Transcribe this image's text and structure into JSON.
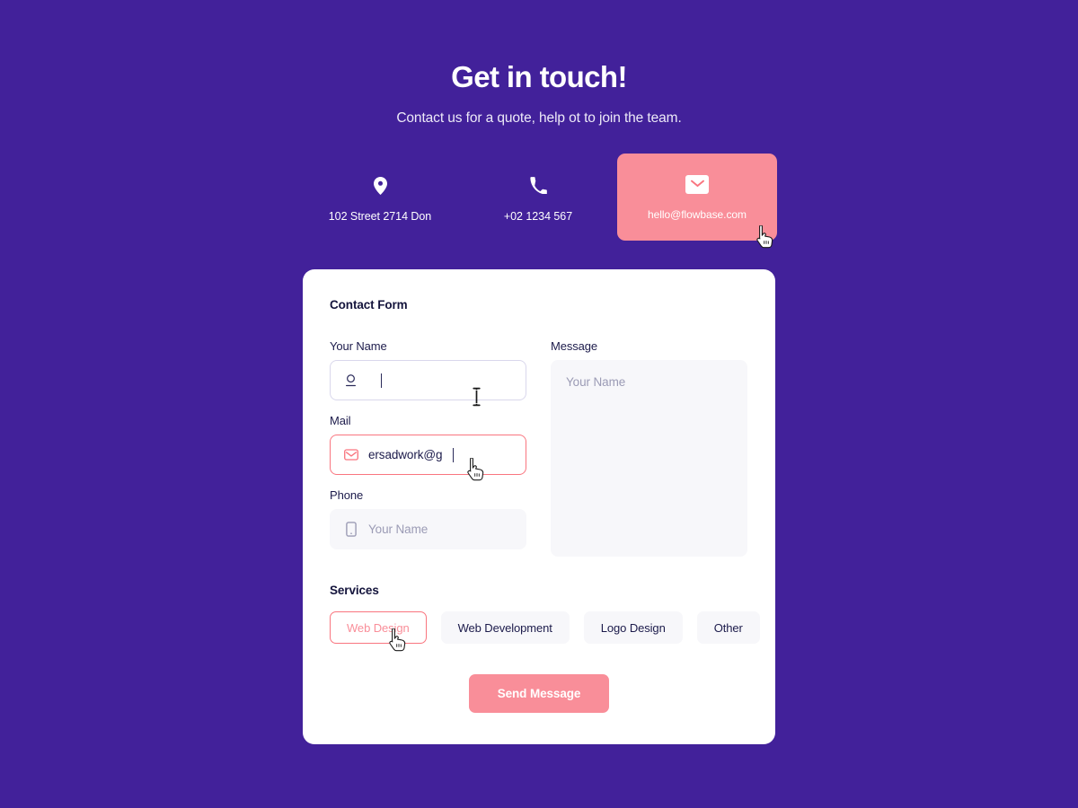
{
  "theme": {
    "background": "#42219A",
    "accent": "#F98E99",
    "accent_border": "#F9757F",
    "card_background": "#FFFFFF",
    "input_background": "#F7F7FA",
    "text_dark": "#1C1B4B",
    "placeholder": "#9B9BB5"
  },
  "hero": {
    "title": "Get in touch!",
    "subtitle": "Contact us for a quote, help ot to join the team."
  },
  "contacts": [
    {
      "icon": "location-pin-icon",
      "label": "102 Street 2714 Don",
      "highlighted": false
    },
    {
      "icon": "phone-icon",
      "label": "+02 1234 567",
      "highlighted": false
    },
    {
      "icon": "mail-icon",
      "label": "hello@flowbase.com",
      "highlighted": true
    }
  ],
  "form": {
    "title": "Contact Form",
    "name_field": {
      "label": "Your Name",
      "value": "",
      "placeholder": "",
      "icon": "user-icon",
      "state": "focused"
    },
    "mail_field": {
      "label": "Mail",
      "value": "ersadwork@g",
      "placeholder": "",
      "icon": "mail-icon",
      "state": "error"
    },
    "phone_field": {
      "label": "Phone",
      "value": "",
      "placeholder": "Your Name",
      "icon": "mobile-icon",
      "state": "idle"
    },
    "message_field": {
      "label": "Message",
      "value": "",
      "placeholder": "Your Name",
      "state": "idle"
    },
    "services": {
      "title": "Services",
      "options": [
        {
          "label": "Web Design",
          "selected": true
        },
        {
          "label": "Web Development",
          "selected": false
        },
        {
          "label": "Logo Design",
          "selected": false
        },
        {
          "label": "Other",
          "selected": false
        }
      ]
    },
    "submit_label": "Send Message"
  }
}
